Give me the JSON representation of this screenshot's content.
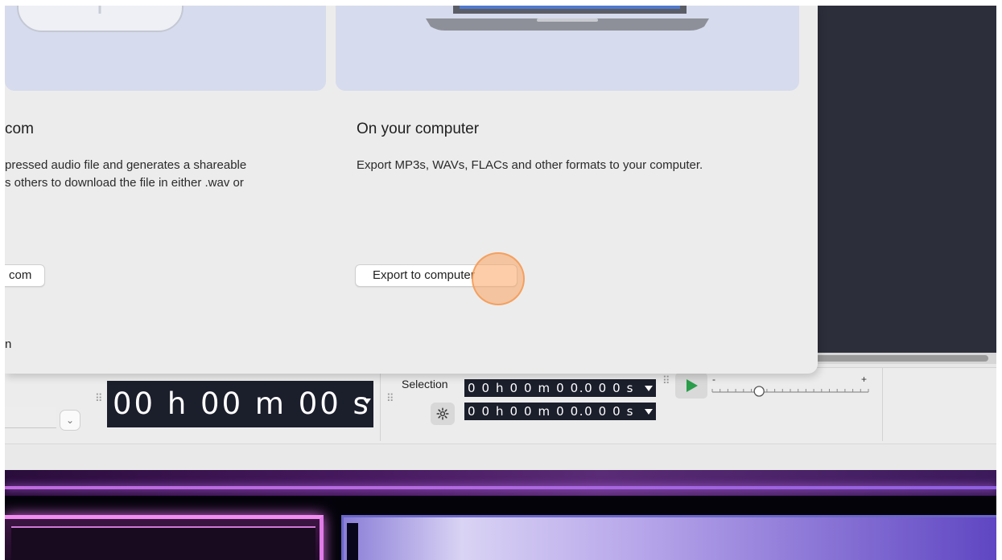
{
  "dialog": {
    "left_card": {
      "title": "com",
      "description": "pressed audio file and generates a shareable\ns others to download the file in either .wav or",
      "button_label": "com"
    },
    "right_card": {
      "title": "On your computer",
      "description": "Export MP3s, WAVs, FLACs and other formats to your computer.",
      "button_label": "Export to computer"
    },
    "footer_text": "n"
  },
  "toolbar": {
    "time_display": "00 h 00 m 00 s",
    "selection_label": "Selection",
    "selection_start": "0 0 h 0 0 m 0 0.0 0 0 s",
    "selection_end": "0 0 h 0 0 m 0 0.0 0 0 s",
    "speed_minus": "-",
    "speed_plus": "+",
    "speed_level": 0.3
  },
  "icons": {
    "combo": "chevron-down-icon",
    "settings": "gear-icon",
    "play": "play-icon",
    "grip": "drag-handle-icon"
  },
  "colors": {
    "time_bg": "#1b1e2b",
    "play_green": "#2a9d4a",
    "click_highlight": "#f9a460",
    "card_image_bg": "#d6dbed"
  }
}
